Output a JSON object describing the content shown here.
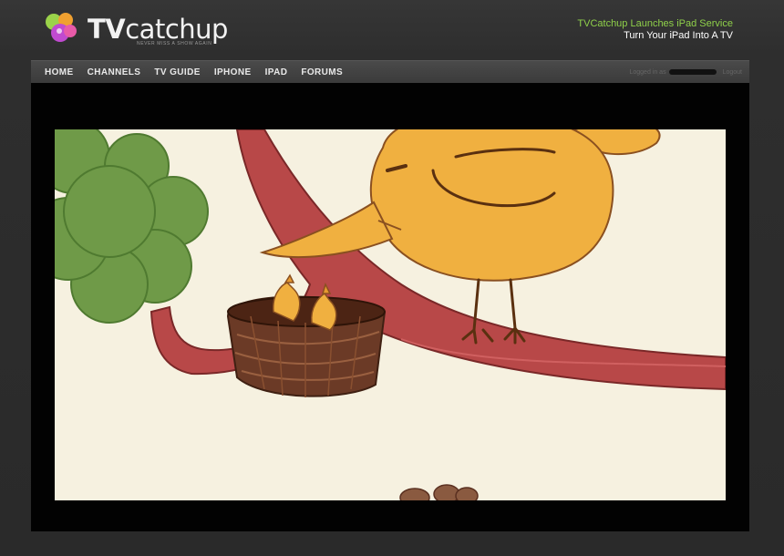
{
  "header": {
    "logo_text_bold": "TV",
    "logo_text_regular": "catchup",
    "tagline": "NEVER MISS A SHOW AGAIN",
    "promo_link": "TVCatchup Launches iPad Service",
    "promo_sub": "Turn Your iPad Into A TV"
  },
  "nav": {
    "items": [
      {
        "label": "HOME"
      },
      {
        "label": "CHANNELS"
      },
      {
        "label": "TV GUIDE"
      },
      {
        "label": "IPHONE"
      },
      {
        "label": "IPAD"
      },
      {
        "label": "FORUMS"
      }
    ],
    "user_prefix": "Logged in as",
    "logout_label": "Logout"
  },
  "player": {
    "scene": "cartoon-bird-nest"
  },
  "colors": {
    "page_bg": "#2b2b2b",
    "nav_bg": "#444444",
    "promo_link": "#8fd04a",
    "video_bg": "#f6f1e0"
  }
}
